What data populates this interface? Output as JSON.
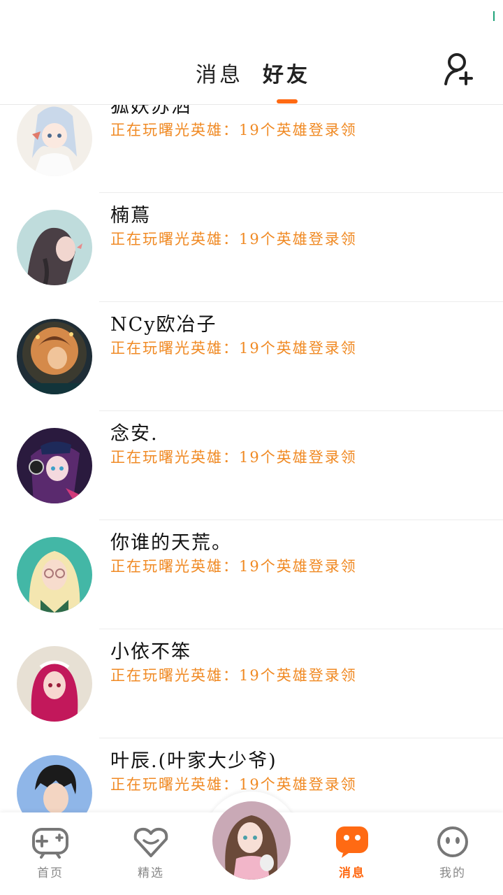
{
  "header": {
    "tabs": [
      {
        "label": "消息",
        "active": false
      },
      {
        "label": "好友",
        "active": true
      }
    ],
    "add_friend_icon": "add-user-icon",
    "accent_color": "#ff6a13"
  },
  "friends": [
    {
      "name": "狐妖苏洒",
      "status": "正在玩曙光英雄：19个英雄登录领"
    },
    {
      "name": "楠蔦",
      "status": "正在玩曙光英雄：19个英雄登录领"
    },
    {
      "name": "NCy欧冶子",
      "status": "正在玩曙光英雄：19个英雄登录领"
    },
    {
      "name": "念安.",
      "status": "正在玩曙光英雄：19个英雄登录领"
    },
    {
      "name": "你谁的天荒。",
      "status": "正在玩曙光英雄：19个英雄登录领"
    },
    {
      "name": "小依不笨",
      "status": "正在玩曙光英雄：19个英雄登录领"
    },
    {
      "name": "叶辰.(叶家大少爷)",
      "status": "正在玩曙光英雄：19个英雄登录领"
    }
  ],
  "bottom_nav": {
    "items": [
      {
        "label": "首页",
        "icon": "gamepad-icon"
      },
      {
        "label": "精选",
        "icon": "heart-diamond-icon"
      },
      {
        "label": "",
        "icon": "profile-avatar"
      },
      {
        "label": "消息",
        "icon": "chat-bubble-icon",
        "active": true
      },
      {
        "label": "我的",
        "icon": "face-icon"
      }
    ]
  }
}
